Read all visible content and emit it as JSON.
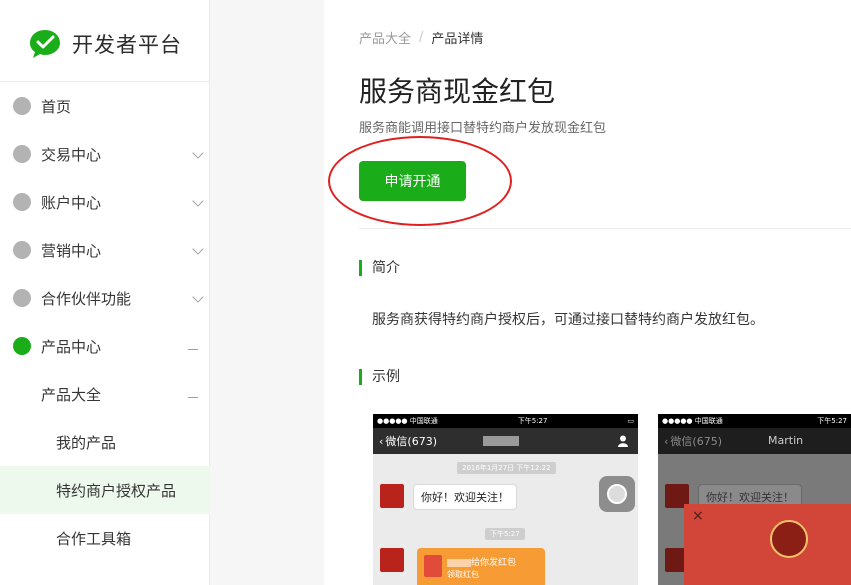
{
  "sidebar": {
    "logo_text": "开发者平台",
    "items": [
      {
        "label": "首页",
        "dot": "gray",
        "indicator": "none"
      },
      {
        "label": "交易中心",
        "dot": "gray",
        "indicator": "chevron"
      },
      {
        "label": "账户中心",
        "dot": "gray",
        "indicator": "chevron"
      },
      {
        "label": "营销中心",
        "dot": "gray",
        "indicator": "chevron"
      },
      {
        "label": "合作伙伴功能",
        "dot": "gray",
        "indicator": "chevron"
      },
      {
        "label": "产品中心",
        "dot": "green",
        "indicator": "dash"
      }
    ],
    "product_all": "产品大全",
    "sub_items": [
      "我的产品",
      "特约商户授权产品",
      "合作工具箱"
    ]
  },
  "breadcrumb": {
    "parent": "产品大全",
    "separator": "/",
    "current": "产品详情"
  },
  "page": {
    "title": "服务商现金红包",
    "description": "服务商能调用接口替特约商户发放现金红包",
    "apply_label": "申请开通"
  },
  "intro": {
    "heading": "简介",
    "text": "服务商获得特约商户授权后，可通过接口替特约商户发放红包。"
  },
  "example": {
    "heading": "示例",
    "phone1": {
      "carrier": "●●●●● 中国联通",
      "time": "下午5:27",
      "back_label": "微信(673)",
      "date_badge": "2016年1月27日 下午12:22",
      "greeting": "你好！欢迎关注！",
      "time_badge2": "下午5:27",
      "redpack_text": "给你发红包",
      "redpack_action": "领取红包"
    },
    "phone2": {
      "carrier": "●●●●● 中国联通",
      "time": "下午5:27",
      "back_label": "微信(675)",
      "contact": "Martin",
      "greeting": "你好！欢迎关注！",
      "close": "×"
    }
  },
  "colors": {
    "accent": "#1aad19",
    "annotation": "#e02020"
  }
}
